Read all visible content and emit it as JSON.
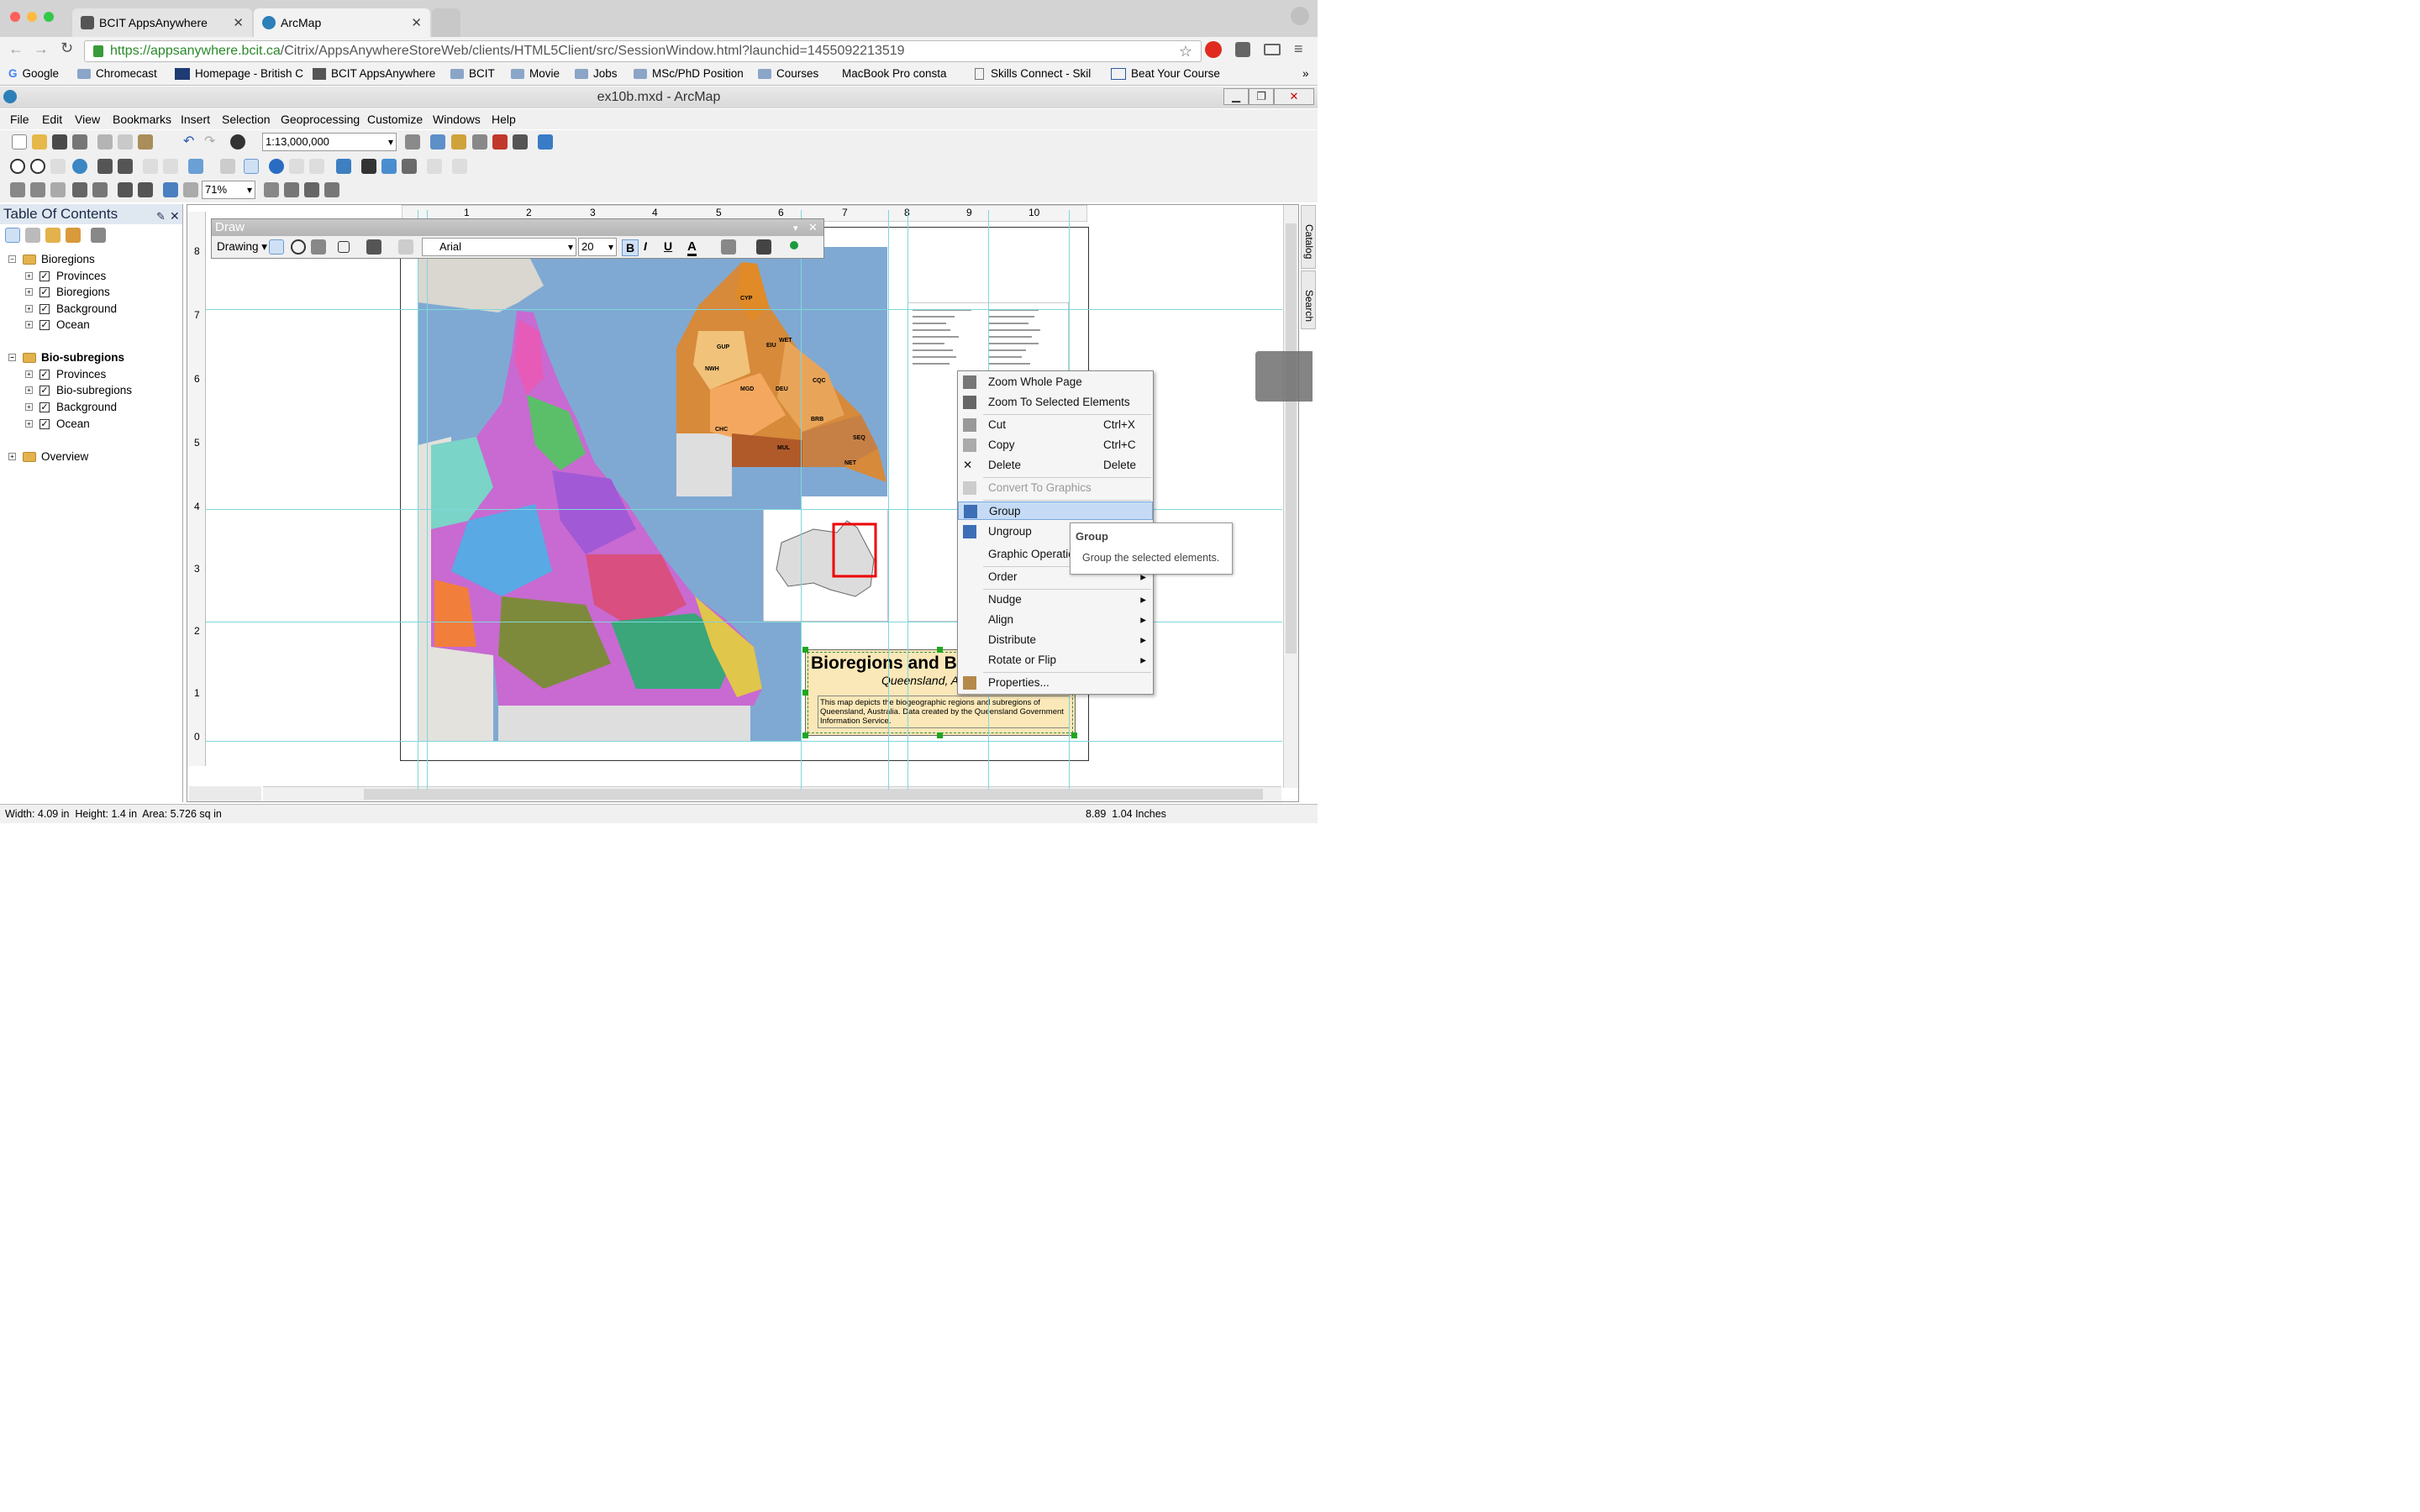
{
  "browser": {
    "tabs": [
      {
        "title": "BCIT AppsAnywhere"
      },
      {
        "title": "ArcMap"
      }
    ],
    "url_host": "https://appsanywhere.bcit.ca",
    "url_path": "/Citrix/AppsAnywhereStoreWeb/clients/HTML5Client/src/SessionWindow.html?launchid=1455092213519",
    "bookmarks": [
      "Google",
      "Chromecast",
      "Homepage - British C",
      "BCIT AppsAnywhere",
      "BCIT",
      "Movie",
      "Jobs",
      "MSc/PhD Position",
      "Courses",
      "MacBook Pro consta",
      "Skills Connect - Skil",
      "Beat Your Course"
    ]
  },
  "app": {
    "window_title": "ex10b.mxd - ArcMap",
    "menus": [
      "File",
      "Edit",
      "View",
      "Bookmarks",
      "Insert",
      "Selection",
      "Geoprocessing",
      "Customize",
      "Windows",
      "Help"
    ],
    "scale": "1:13,000,000",
    "zoom": "71%"
  },
  "toc": {
    "title": "Table Of Contents",
    "groups": [
      {
        "name": "Bioregions",
        "layers": [
          "Provinces",
          "Bioregions",
          "Background",
          "Ocean"
        ]
      },
      {
        "name": "Bio-subregions",
        "layers": [
          "Provinces",
          "Bio-subregions",
          "Background",
          "Ocean"
        ]
      },
      {
        "name": "Overview",
        "layers": []
      }
    ]
  },
  "draw_toolbar": {
    "title": "Draw",
    "drawing_menu": "Drawing",
    "font": "Arial",
    "size": "20",
    "bold": "B",
    "italic": "I",
    "underline": "U"
  },
  "map": {
    "title_text": "Bioregions and Bi",
    "subtitle_text": "Queensland, A",
    "description": "This map depicts the biogeographic regions and subregions of Queensland, Australia. Data created by the Queensland Government Information Service.",
    "ruler_top": [
      "1",
      "2",
      "3",
      "4",
      "5",
      "6",
      "7",
      "8",
      "9",
      "10"
    ],
    "ruler_left": [
      "8",
      "7",
      "6",
      "5",
      "4",
      "3",
      "2",
      "1",
      "0"
    ],
    "region_codes": [
      "CYP",
      "WET",
      "EIU",
      "GUP",
      "NWH",
      "MGD",
      "DEU",
      "CQC",
      "BRB",
      "SEQ",
      "CHC",
      "MUL",
      "NET"
    ]
  },
  "context_menu": {
    "items": [
      {
        "label": "Zoom Whole Page",
        "shortcut": ""
      },
      {
        "label": "Zoom To Selected Elements",
        "shortcut": ""
      },
      {
        "label": "Cut",
        "shortcut": "Ctrl+X"
      },
      {
        "label": "Copy",
        "shortcut": "Ctrl+C"
      },
      {
        "label": "Delete",
        "shortcut": "Delete"
      },
      {
        "label": "Convert To Graphics",
        "shortcut": ""
      },
      {
        "label": "Group",
        "shortcut": ""
      },
      {
        "label": "Ungroup",
        "shortcut": ""
      },
      {
        "label": "Graphic Operatio",
        "shortcut": ""
      },
      {
        "label": "Order",
        "shortcut": ""
      },
      {
        "label": "Nudge",
        "shortcut": ""
      },
      {
        "label": "Align",
        "shortcut": ""
      },
      {
        "label": "Distribute",
        "shortcut": ""
      },
      {
        "label": "Rotate or Flip",
        "shortcut": ""
      },
      {
        "label": "Properties...",
        "shortcut": ""
      }
    ],
    "highlighted": "Group"
  },
  "tooltip": {
    "title": "Group",
    "text": "Group the selected elements."
  },
  "side_tabs": [
    "Catalog",
    "Search"
  ],
  "status": {
    "left": "Width: 4.09 in  Height: 1.4 in  Area: 5.726 sq in",
    "right": "8.89  1.04 Inches"
  },
  "colors": {
    "accent": "#3d6fb6",
    "selection": "#c5dbf5",
    "guide": "#7fd6dc",
    "ocean": "#7fa9d3"
  }
}
